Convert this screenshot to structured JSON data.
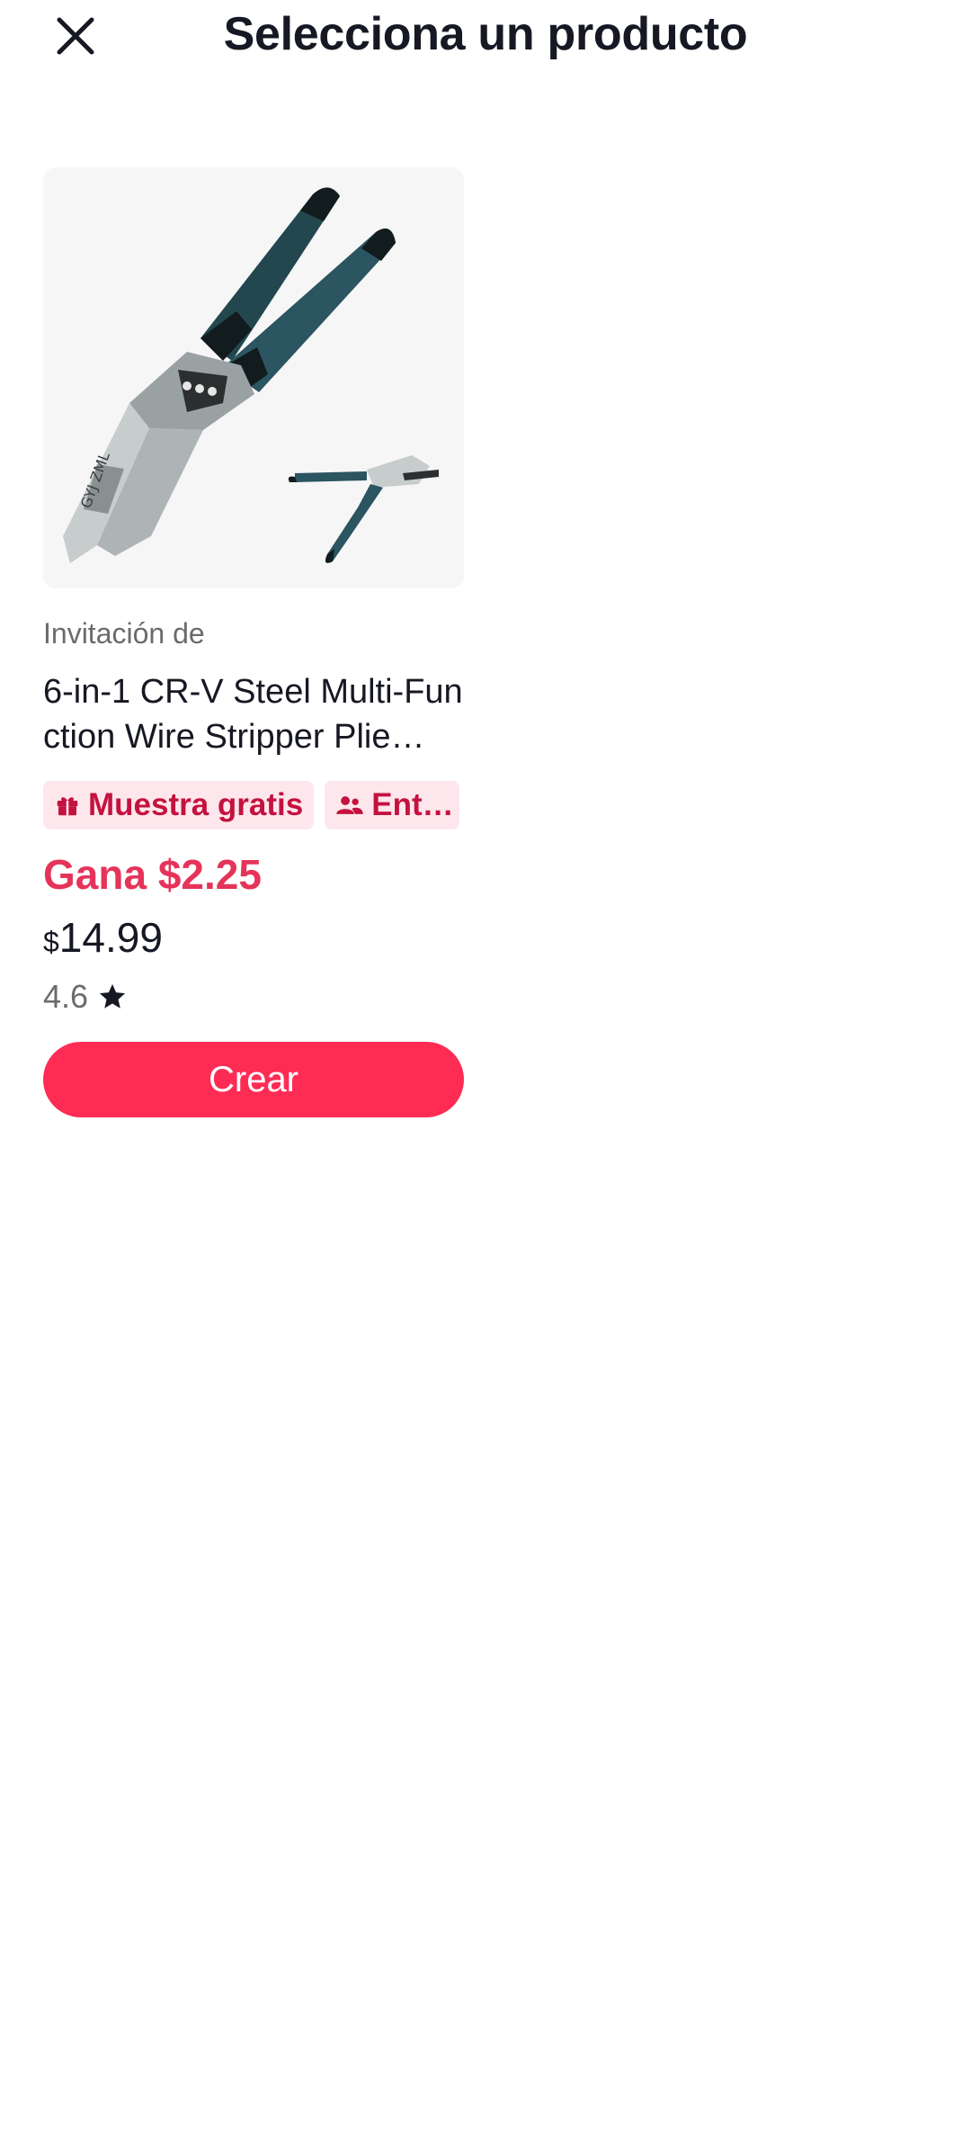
{
  "header": {
    "title": "Selecciona un producto",
    "close_icon": "close-icon"
  },
  "product": {
    "image_icon": "pliers-image",
    "invite_label": "Invitación de",
    "name": "6-in-1 CR-V Steel Multi-Function Wire Stripper Plie…",
    "tags": [
      {
        "icon": "gift-icon",
        "label": "Muestra gratis"
      },
      {
        "icon": "users-icon",
        "label": "Ent…"
      }
    ],
    "earn": "Gana $2.25",
    "price_currency": "$",
    "price_amount": "14.99",
    "rating": "4.6",
    "rating_icon": "star-icon",
    "create_label": "Crear"
  },
  "colors": {
    "accent": "#fe2c55",
    "earn": "#e5345a",
    "tag_bg": "#fde7ec",
    "tag_text": "#c4123f"
  }
}
